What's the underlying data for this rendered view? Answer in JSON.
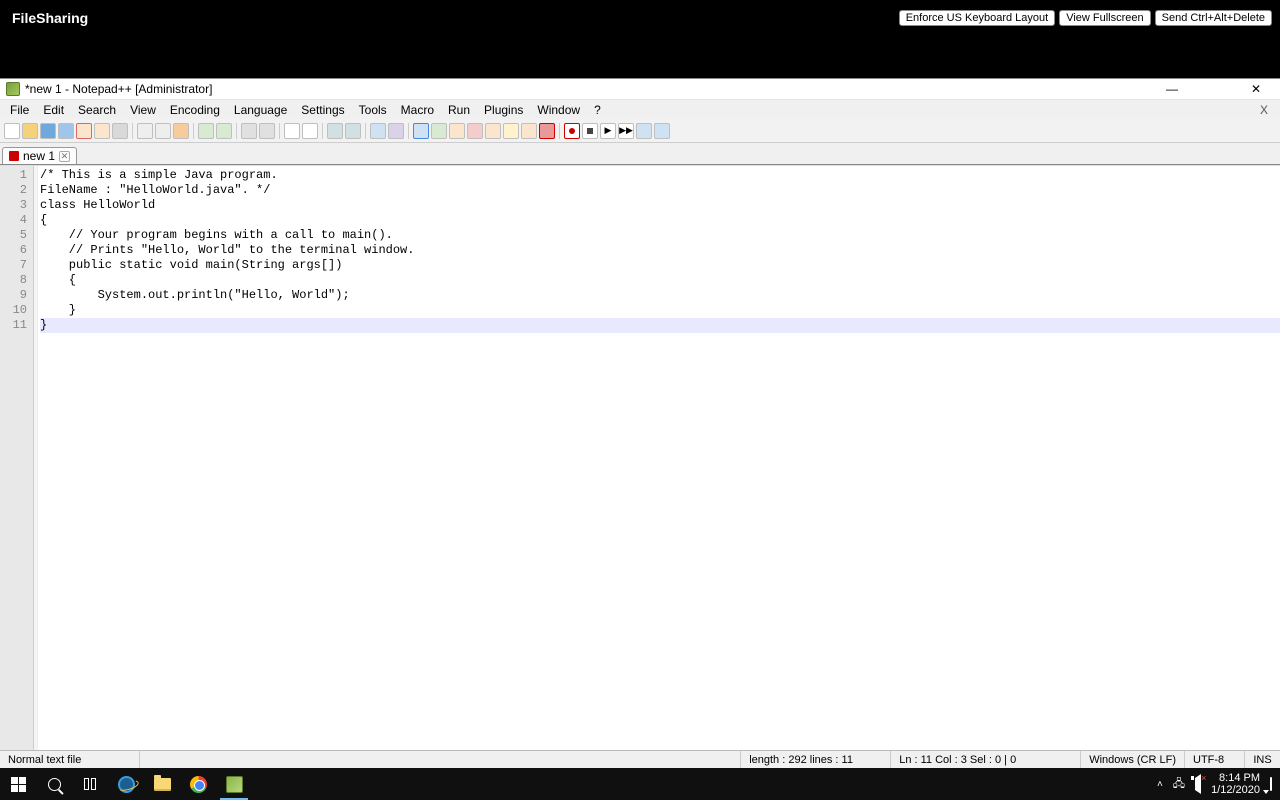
{
  "vnc": {
    "title": "FileSharing",
    "buttons": [
      "Enforce US Keyboard Layout",
      "View Fullscreen",
      "Send Ctrl+Alt+Delete"
    ]
  },
  "window": {
    "title": "*new 1 - Notepad++ [Administrator]"
  },
  "menu": {
    "items": [
      "File",
      "Edit",
      "Search",
      "View",
      "Encoding",
      "Language",
      "Settings",
      "Tools",
      "Macro",
      "Run",
      "Plugins",
      "Window",
      "?"
    ],
    "close_doc": "X"
  },
  "tab": {
    "label": "new 1"
  },
  "code": {
    "lines": [
      "/* This is a simple Java program.",
      "FileName : \"HelloWorld.java\". */",
      "class HelloWorld",
      "{",
      "    // Your program begins with a call to main().",
      "    // Prints \"Hello, World\" to the terminal window.",
      "    public static void main(String args[])",
      "    {",
      "        System.out.println(\"Hello, World\");",
      "    }",
      "}"
    ],
    "current_line_index": 10
  },
  "status": {
    "file_type": "Normal text file",
    "length_lines": "length : 292    lines : 11",
    "caret": "Ln : 11    Col : 3    Sel : 0 | 0",
    "eol": "Windows (CR LF)",
    "encoding": "UTF-8",
    "mode": "INS"
  },
  "taskbar": {
    "time": "8:14 PM",
    "date": "1/12/2020"
  }
}
